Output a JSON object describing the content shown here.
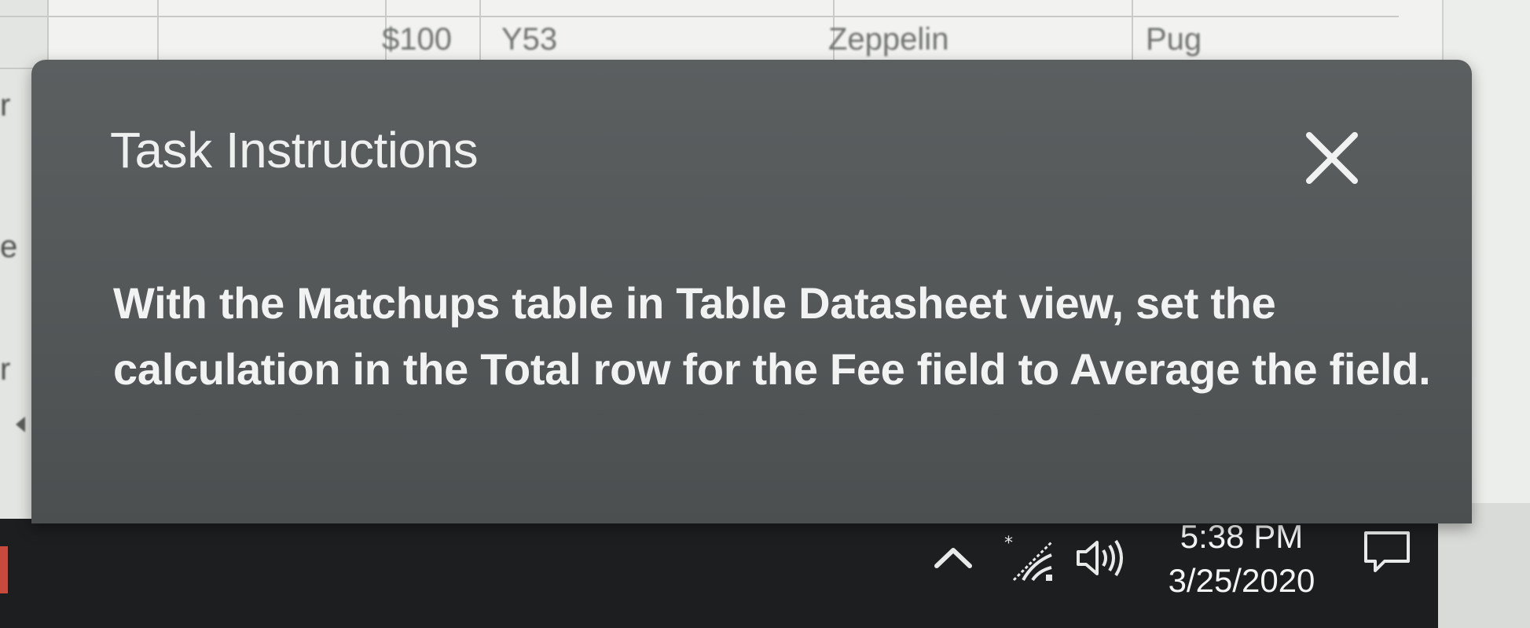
{
  "background": {
    "table_cells": {
      "fee": "$100",
      "id": "Y53",
      "name": "Zeppelin",
      "breed": "Pug"
    },
    "row_fragments": [
      "r",
      "e",
      "r"
    ]
  },
  "task_panel": {
    "title": "Task Instructions",
    "close_icon": "close-icon",
    "instruction": "With the Matchups table in Table Datasheet view, set the calculation in the Total row for the Fee field to Average the field."
  },
  "taskbar": {
    "tray_icons": [
      "chevron-up-icon",
      "wifi-icon",
      "volume-icon",
      "notification-icon"
    ],
    "clock_time": "5:38 PM",
    "clock_date": "3/25/2020"
  },
  "colors": {
    "panel_bg": "#555859",
    "taskbar_bg": "#1c1e1f",
    "text_light": "#f1f3f3"
  }
}
